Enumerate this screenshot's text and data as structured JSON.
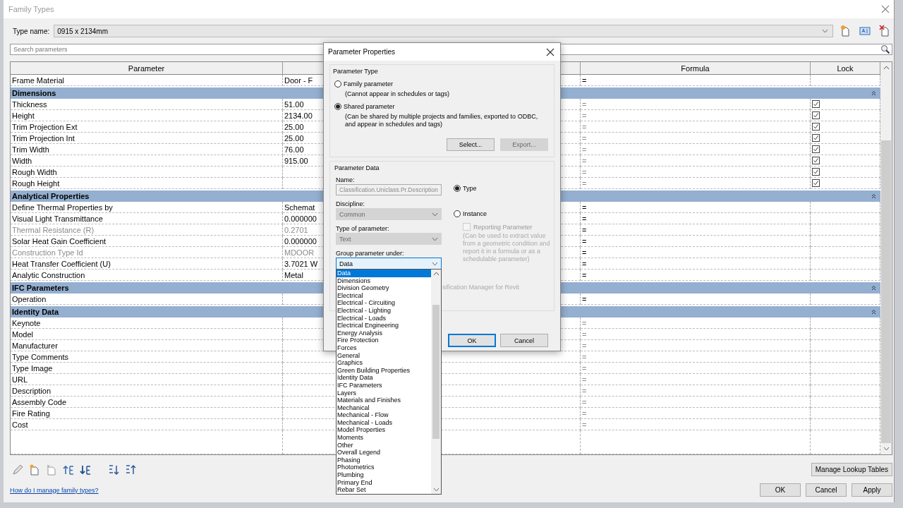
{
  "window": {
    "title": "Family Types"
  },
  "type_name": {
    "label": "Type name:",
    "value": "0915 x 2134mm"
  },
  "search": {
    "placeholder": "Search parameters"
  },
  "table": {
    "columns": [
      "Parameter",
      "Formula",
      "Lock"
    ],
    "rows": [
      {
        "kind": "param",
        "name": "Frame Material",
        "value": "Door - F",
        "formula": "=",
        "formula_disabled": false,
        "disabled": false
      },
      {
        "kind": "group",
        "name": "Dimensions",
        "expanded": true
      },
      {
        "kind": "param",
        "name": "Thickness",
        "value": "51.00",
        "formula": "=",
        "formula_disabled": true,
        "disabled": false,
        "locked": true
      },
      {
        "kind": "param",
        "name": "Height",
        "value": "2134.00",
        "formula": "=",
        "formula_disabled": true,
        "disabled": false,
        "locked": true
      },
      {
        "kind": "param",
        "name": "Trim Projection Ext",
        "value": "25.00",
        "formula": "=",
        "formula_disabled": true,
        "disabled": false,
        "locked": true
      },
      {
        "kind": "param",
        "name": "Trim Projection Int",
        "value": "25.00",
        "formula": "=",
        "formula_disabled": true,
        "disabled": false,
        "locked": true
      },
      {
        "kind": "param",
        "name": "Trim Width",
        "value": "76.00",
        "formula": "=",
        "formula_disabled": true,
        "disabled": false,
        "locked": true
      },
      {
        "kind": "param",
        "name": "Width",
        "value": "915.00",
        "formula": "=",
        "formula_disabled": true,
        "disabled": false,
        "locked": true
      },
      {
        "kind": "param",
        "name": "Rough Width",
        "formula": "=",
        "formula_disabled": true,
        "disabled": false,
        "locked": true
      },
      {
        "kind": "param",
        "name": "Rough Height",
        "formula": "=",
        "formula_disabled": true,
        "disabled": false,
        "locked": true
      },
      {
        "kind": "group",
        "name": "Analytical Properties",
        "expanded": true
      },
      {
        "kind": "param",
        "name": "Define Thermal Properties by",
        "value": "Schemat",
        "formula": "=",
        "formula_disabled": false,
        "disabled": false
      },
      {
        "kind": "param",
        "name": "Visual Light Transmittance",
        "value": "0.000000",
        "formula": "=",
        "formula_disabled": false,
        "disabled": false
      },
      {
        "kind": "param",
        "name": "Thermal Resistance (R)",
        "value": "0.2701",
        "formula": "=",
        "formula_disabled": false,
        "disabled": true
      },
      {
        "kind": "param",
        "name": "Solar Heat Gain Coefficient",
        "value": "0.000000",
        "formula": "=",
        "formula_disabled": false,
        "disabled": false
      },
      {
        "kind": "param",
        "name": "Construction Type Id",
        "value": "MDOOR",
        "formula": "=",
        "formula_disabled": false,
        "disabled": true
      },
      {
        "kind": "param",
        "name": "Heat Transfer Coefficient (U)",
        "value": "3.7021 W",
        "formula": "=",
        "formula_disabled": false,
        "disabled": false
      },
      {
        "kind": "param",
        "name": "Analytic Construction",
        "value": "Metal",
        "formula": "=",
        "formula_disabled": false,
        "disabled": false
      },
      {
        "kind": "group",
        "name": "IFC Parameters",
        "expanded": true
      },
      {
        "kind": "param",
        "name": "Operation",
        "formula": "=",
        "formula_disabled": false,
        "disabled": false
      },
      {
        "kind": "group",
        "name": "Identity Data",
        "expanded": true
      },
      {
        "kind": "param",
        "name": "Keynote",
        "formula": "=",
        "formula_disabled": true,
        "disabled": false
      },
      {
        "kind": "param",
        "name": "Model",
        "formula": "=",
        "formula_disabled": true,
        "disabled": false
      },
      {
        "kind": "param",
        "name": "Manufacturer",
        "formula": "=",
        "formula_disabled": true,
        "disabled": false
      },
      {
        "kind": "param",
        "name": "Type Comments",
        "formula": "=",
        "formula_disabled": true,
        "disabled": false
      },
      {
        "kind": "param",
        "name": "Type Image",
        "formula": "=",
        "formula_disabled": true,
        "disabled": false
      },
      {
        "kind": "param",
        "name": "URL",
        "formula": "=",
        "formula_disabled": true,
        "disabled": false
      },
      {
        "kind": "param",
        "name": "Description",
        "formula": "=",
        "formula_disabled": true,
        "disabled": false
      },
      {
        "kind": "param",
        "name": "Assembly Code",
        "formula": "=",
        "formula_disabled": true,
        "disabled": false
      },
      {
        "kind": "param",
        "name": "Fire Rating",
        "formula": "=",
        "formula_disabled": true,
        "disabled": false
      },
      {
        "kind": "param",
        "name": "Cost",
        "formula": "=",
        "formula_disabled": true,
        "disabled": false
      }
    ]
  },
  "manage_button": "Manage Lookup Tables",
  "help_link": "How do I manage family types?",
  "buttons": [
    "OK",
    "Cancel",
    "Apply"
  ],
  "parameter_properties": {
    "title": "Parameter Properties",
    "parameter_type": {
      "label": "Parameter Type",
      "options": [
        {
          "label": "Family parameter",
          "note": "(Cannot appear in schedules or tags)",
          "selected": false
        },
        {
          "label": "Shared parameter",
          "note": "(Can be shared by multiple projects and families, exported to ODBC, and appear in schedules and tags)",
          "selected": true
        }
      ],
      "buttons": [
        {
          "label": "Select...",
          "disabled": false
        },
        {
          "label": "Export...",
          "disabled": true
        }
      ]
    },
    "parameter_data": {
      "label": "Parameter Data",
      "name_label": "Name:",
      "name_value": "Classification.Uniclass.Pr.Description",
      "discipline_label": "Discipline:",
      "discipline_value": "Common",
      "type_label": "Type of parameter:",
      "type_value": "Text",
      "group_label": "Group parameter under:",
      "group_value": "Data",
      "scope": [
        {
          "label": "Type",
          "selected": true
        },
        {
          "label": "Instance",
          "selected": false
        }
      ],
      "reporting": {
        "label": "Reporting Parameter",
        "checked": false,
        "disabled": true
      },
      "reporting_note": "(Can be used to extract value from a geometric condition and report it in a formula or as a schedulable parameter)",
      "partial_note": "sification Manager for Revit"
    },
    "buttons": [
      "OK",
      "Cancel"
    ],
    "dropdown": {
      "items": [
        {
          "label": "Data",
          "selected": true
        },
        {
          "label": "Dimensions",
          "selected": false
        },
        {
          "label": "Division Geometry",
          "selected": false
        },
        {
          "label": "Electrical",
          "selected": false
        },
        {
          "label": "Electrical - Circuiting",
          "selected": false
        },
        {
          "label": "Electrical - Lighting",
          "selected": false
        },
        {
          "label": "Electrical - Loads",
          "selected": false
        },
        {
          "label": "Electrical Engineering",
          "selected": false
        },
        {
          "label": "Energy Analysis",
          "selected": false
        },
        {
          "label": "Fire Protection",
          "selected": false
        },
        {
          "label": "Forces",
          "selected": false
        },
        {
          "label": "General",
          "selected": false
        },
        {
          "label": "Graphics",
          "selected": false
        },
        {
          "label": "Green Building Properties",
          "selected": false
        },
        {
          "label": "Identity Data",
          "selected": false
        },
        {
          "label": "IFC Parameters",
          "selected": false
        },
        {
          "label": "Layers",
          "selected": false
        },
        {
          "label": "Materials and Finishes",
          "selected": false
        },
        {
          "label": "Mechanical",
          "selected": false
        },
        {
          "label": "Mechanical - Flow",
          "selected": false
        },
        {
          "label": "Mechanical - Loads",
          "selected": false
        },
        {
          "label": "Model Properties",
          "selected": false
        },
        {
          "label": "Moments",
          "selected": false
        },
        {
          "label": "Other",
          "selected": false
        },
        {
          "label": "Overall Legend",
          "selected": false
        },
        {
          "label": "Phasing",
          "selected": false
        },
        {
          "label": "Photometrics",
          "selected": false
        },
        {
          "label": "Plumbing",
          "selected": false
        },
        {
          "label": "Primary End",
          "selected": false
        },
        {
          "label": "Rebar Set",
          "selected": false
        }
      ]
    }
  }
}
